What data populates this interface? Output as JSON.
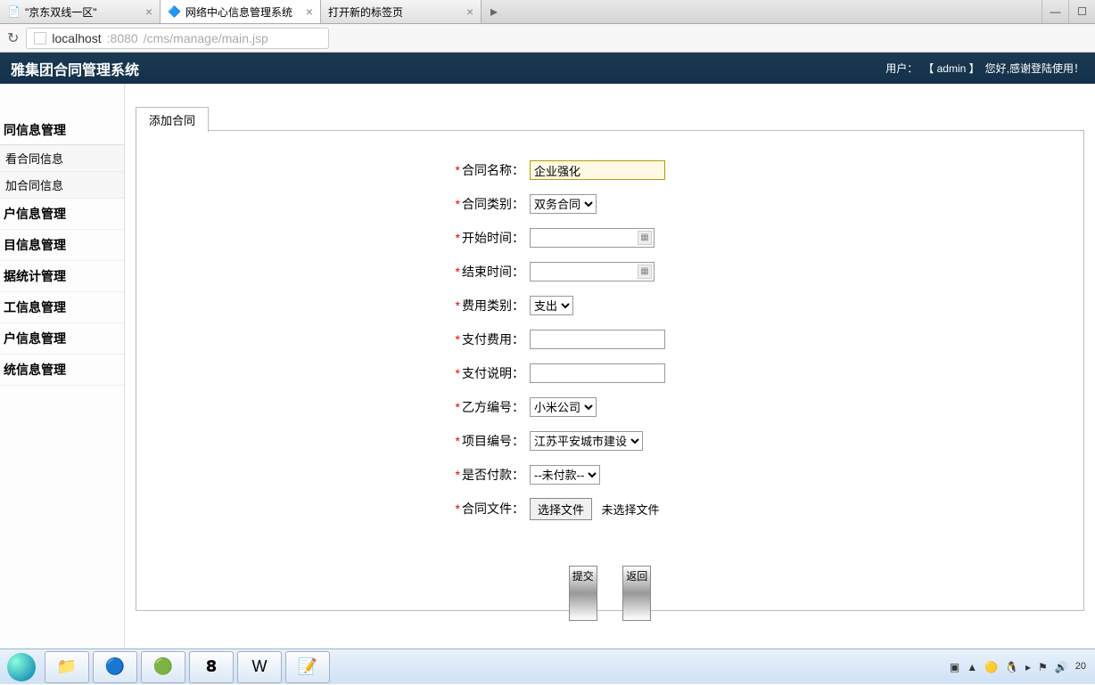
{
  "browser": {
    "tabs": [
      {
        "title": "\"京东双线一区\"",
        "active": false
      },
      {
        "title": "网络中心信息管理系统",
        "active": true
      },
      {
        "title": "打开新的标签页",
        "active": false
      }
    ],
    "url_host": "localhost",
    "url_port": ":8080",
    "url_path": "/cms/manage/main.jsp"
  },
  "header": {
    "title": "雅集团合同管理系统",
    "user_label": "用户：",
    "user_bracket": "【 admin 】",
    "greeting": "您好,感谢登陆使用！"
  },
  "sidebar": {
    "section1": "同信息管理",
    "sub1": "看合同信息",
    "sub2": "加合同信息",
    "items": [
      "户信息管理",
      "目信息管理",
      "据统计管理",
      "工信息管理",
      "户信息管理",
      "统信息管理"
    ]
  },
  "tabStrip": {
    "label": "添加合同"
  },
  "form": {
    "name": {
      "label": "合同名称：",
      "value": "企业强化"
    },
    "type": {
      "label": "合同类别：",
      "selected": "双务合同"
    },
    "start": {
      "label": "开始时间：",
      "value": ""
    },
    "end": {
      "label": "结束时间：",
      "value": ""
    },
    "feeType": {
      "label": "费用类别：",
      "selected": "支出"
    },
    "payFee": {
      "label": "支付费用：",
      "value": ""
    },
    "payDesc": {
      "label": "支付说明：",
      "value": ""
    },
    "partyB": {
      "label": "乙方编号：",
      "selected": "小米公司"
    },
    "project": {
      "label": "项目编号：",
      "selected": "江苏平安城市建设"
    },
    "paid": {
      "label": "是否付款：",
      "selected": "--未付款--"
    },
    "file": {
      "label": "合同文件：",
      "button": "选择文件",
      "status": "未选择文件"
    }
  },
  "actions": {
    "submit": "提交",
    "back": "返回"
  },
  "taskbar": {
    "time": "20"
  }
}
